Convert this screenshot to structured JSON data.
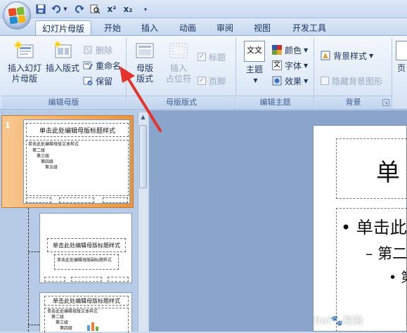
{
  "qat": {
    "undo_icon": "undo-icon",
    "redo_icon": "redo-icon",
    "superscript": "x²",
    "subscript": "x₂"
  },
  "tabs": [
    {
      "label": "幻灯片母版",
      "active": true
    },
    {
      "label": "开始"
    },
    {
      "label": "插入"
    },
    {
      "label": "动画"
    },
    {
      "label": "审阅"
    },
    {
      "label": "视图"
    },
    {
      "label": "开发工具"
    }
  ],
  "ribbon": {
    "edit_master": {
      "label": "编辑母版",
      "insert_slide_master_line1": "插入幻灯",
      "insert_slide_master_line2": "片母版",
      "insert_layout": "插入版式",
      "delete": "删除",
      "rename": "重命名",
      "preserve": "保留"
    },
    "master_layout": {
      "label": "母版版式",
      "master_layout_line1": "母版",
      "master_layout_line2": "版式",
      "insert_placeholder_line1": "插入",
      "insert_placeholder_line2": "占位符",
      "title_check": "标题",
      "footer_check": "页脚"
    },
    "edit_theme": {
      "label": "编辑主题",
      "themes": "主题",
      "theme_icon_text": "文文",
      "colors": "颜色",
      "fonts": "字体",
      "effects": "效果",
      "font_icon_text": "文"
    },
    "background": {
      "label": "背景",
      "background_styles": "背景样式",
      "hide_background": "隐藏背景图形"
    },
    "overflow_label": "页"
  },
  "slides_panel": {
    "slide_number": "1",
    "master_title": "单击此处编辑母版标题样式",
    "master_body": "单击此处编辑母版文本样式",
    "level2": "第二级",
    "level3": "第三级",
    "level4": "第四级",
    "level5": "第五级",
    "layout1_title": "单击此处编辑母版标题样式",
    "layout1_subtitle": "单击此处编辑母版副标题样式",
    "layout2_title": "单击此处编辑母版标题样式",
    "layout2_body": "单击此处编辑母版文本样式"
  },
  "main_slide": {
    "title_fragment": "单",
    "bullet1": "• 单击此",
    "bullet2": "– 第二",
    "bullet3": "• 第"
  },
  "watermark": {
    "text": "Bai🐾经验",
    "sub": "jingyan.baidu.com"
  },
  "colors": {
    "accent_orange": "#e8963f",
    "ribbon_blue": "#c6d8f0",
    "arrow_red": "#e5322b"
  }
}
